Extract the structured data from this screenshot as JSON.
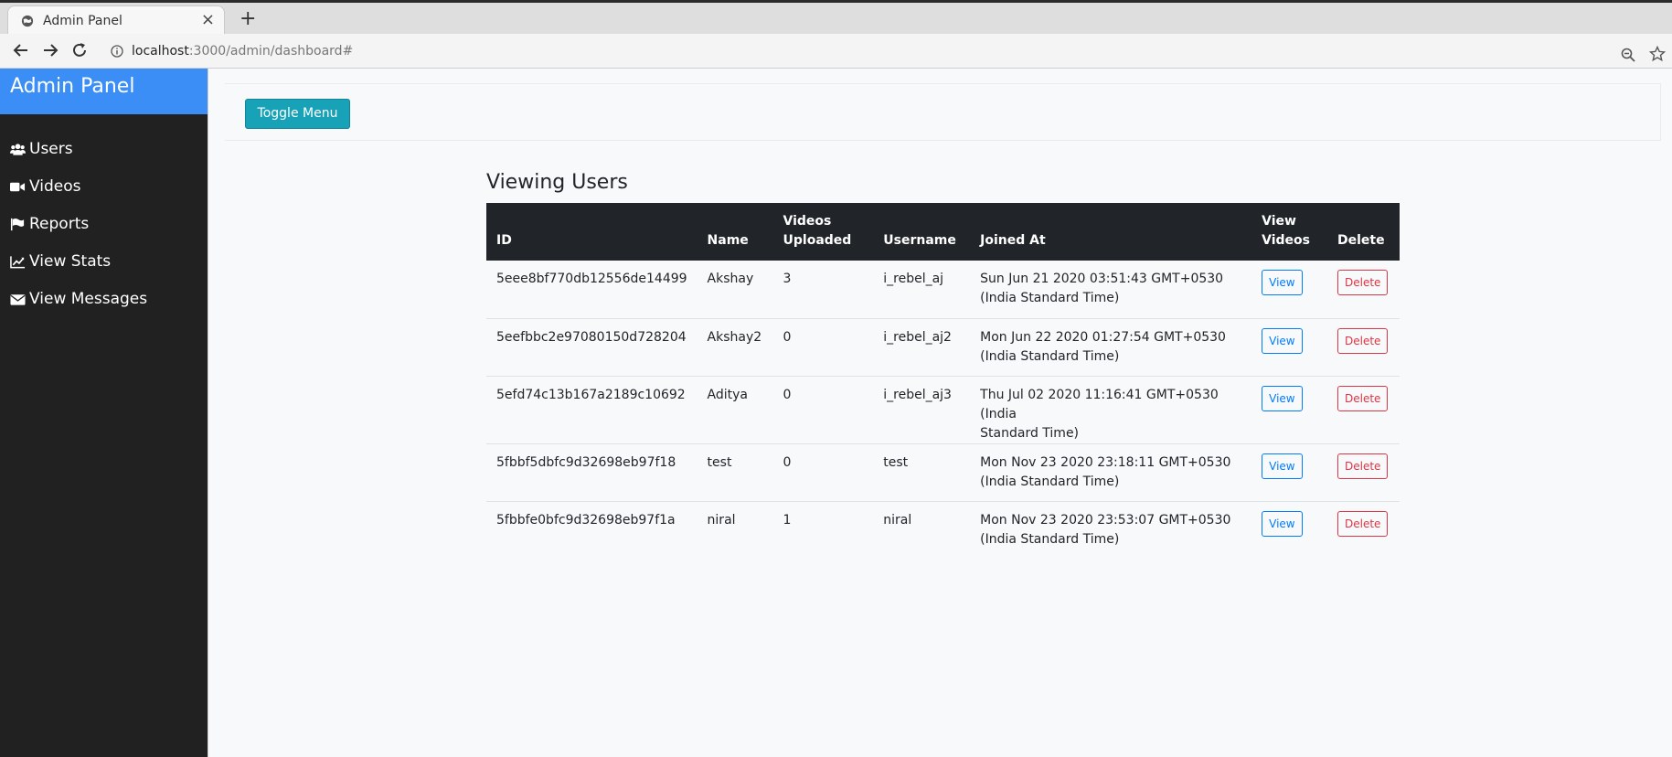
{
  "browser": {
    "tab_title": "Admin Panel",
    "url_host": "localhost",
    "url_rest": ":3000/admin/dashboard#"
  },
  "sidebar": {
    "title": "Admin Panel",
    "items": [
      {
        "label": "Users",
        "icon": "users-icon"
      },
      {
        "label": "Videos",
        "icon": "video-camera-icon"
      },
      {
        "label": "Reports",
        "icon": "flag-icon"
      },
      {
        "label": "View Stats",
        "icon": "line-chart-icon"
      },
      {
        "label": "View Messages",
        "icon": "envelope-icon"
      }
    ]
  },
  "main": {
    "toggle_label": "Toggle Menu",
    "title": "Viewing Users",
    "columns": {
      "id": "ID",
      "name": "Name",
      "videos_line1": "Videos",
      "videos_line2": "Uploaded",
      "username": "Username",
      "joined": "Joined At",
      "view_line1": "View",
      "view_line2": "Videos",
      "delete": "Delete"
    },
    "rows": [
      {
        "id": "5eee8bf770db12556de14499",
        "name": "Akshay",
        "videos": "3",
        "username": "i_rebel_aj",
        "joined1": "Sun Jun 21 2020 03:51:43 GMT+0530",
        "joined2": "(India Standard Time)",
        "view": "View",
        "delete": "Delete"
      },
      {
        "id": "5eefbbc2e97080150d728204",
        "name": "Akshay2",
        "videos": "0",
        "username": "i_rebel_aj2",
        "joined1": "Mon Jun 22 2020 01:27:54 GMT+0530",
        "joined2": "(India Standard Time)",
        "view": "View",
        "delete": "Delete"
      },
      {
        "id": "5efd74c13b167a2189c10692",
        "name": "Aditya",
        "videos": "0",
        "username": "i_rebel_aj3",
        "joined1": "Thu Jul 02 2020 11:16:41 GMT+0530 (India",
        "joined2": "Standard Time)",
        "view": "View",
        "delete": "Delete"
      },
      {
        "id": "5fbbf5dbfc9d32698eb97f18",
        "name": "test",
        "videos": "0",
        "username": "test",
        "joined1": "Mon Nov 23 2020 23:18:11 GMT+0530",
        "joined2": "(India Standard Time)",
        "view": "View",
        "delete": "Delete"
      },
      {
        "id": "5fbbfe0bfc9d32698eb97f1a",
        "name": "niral",
        "videos": "1",
        "username": "niral",
        "joined1": "Mon Nov 23 2020 23:53:07 GMT+0530",
        "joined2": "(India Standard Time)",
        "view": "View",
        "delete": "Delete"
      }
    ]
  },
  "colors": {
    "sidebar_bg": "#212121",
    "sidebar_header": "#3a8ef6",
    "toggle_button": "#17a2b8",
    "table_head": "#212529",
    "view_button": "#007bff",
    "delete_button": "#dc3545"
  }
}
